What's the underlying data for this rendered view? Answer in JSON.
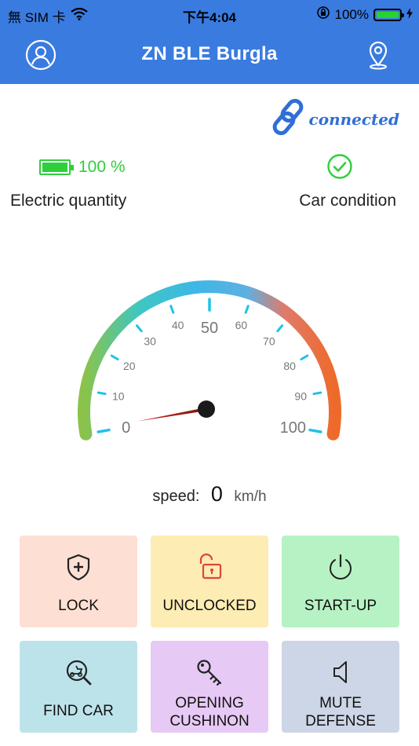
{
  "status_bar": {
    "carrier": "無 SIM 卡",
    "time": "下午4:04",
    "battery": "100%"
  },
  "nav": {
    "title": "ZN BLE Burgla",
    "left_icon": "user-circle-icon",
    "right_icon": "location-pin-icon"
  },
  "connection": {
    "status": "connected",
    "icon": "chain-link-icon"
  },
  "stats": {
    "battery_percent": "100 %",
    "battery_label": "Electric quantity",
    "condition_label": "Car condition",
    "condition_icon": "check-circle-icon"
  },
  "gauge": {
    "ticks": [
      "0",
      "10",
      "20",
      "30",
      "40",
      "50",
      "60",
      "70",
      "80",
      "90",
      "100"
    ],
    "value": 0,
    "min": 0,
    "max": 100
  },
  "speed": {
    "label": "speed:",
    "value": "0",
    "unit": "km/h"
  },
  "actions": [
    {
      "label": "LOCK",
      "icon": "shield-plus-icon",
      "bg": "#fde0d3"
    },
    {
      "label": "UNCLOCKED",
      "icon": "unlocked-padlock-icon",
      "bg": "#fdecb3"
    },
    {
      "label": "START-UP",
      "icon": "power-icon",
      "bg": "#b6f2c3"
    },
    {
      "label": "FIND CAR",
      "icon": "scooter-search-icon",
      "bg": "#bde3ea"
    },
    {
      "label": "OPENING\nCUSHINON",
      "label_line1": "OPENING",
      "label_line2": "CUSHINON",
      "icon": "key-icon",
      "bg": "#e6c9f4"
    },
    {
      "label": "MUTE\nDEFENSE",
      "label_line1": "MUTE",
      "label_line2": "DEFENSE",
      "icon": "speaker-mute-icon",
      "bg": "#ccd6e6"
    }
  ],
  "colors": {
    "header_bg": "#3a7be0",
    "accent_blue": "#2f6fd6",
    "battery_green": "#2ecf3c",
    "tick_cyan": "#1ec3e6"
  }
}
